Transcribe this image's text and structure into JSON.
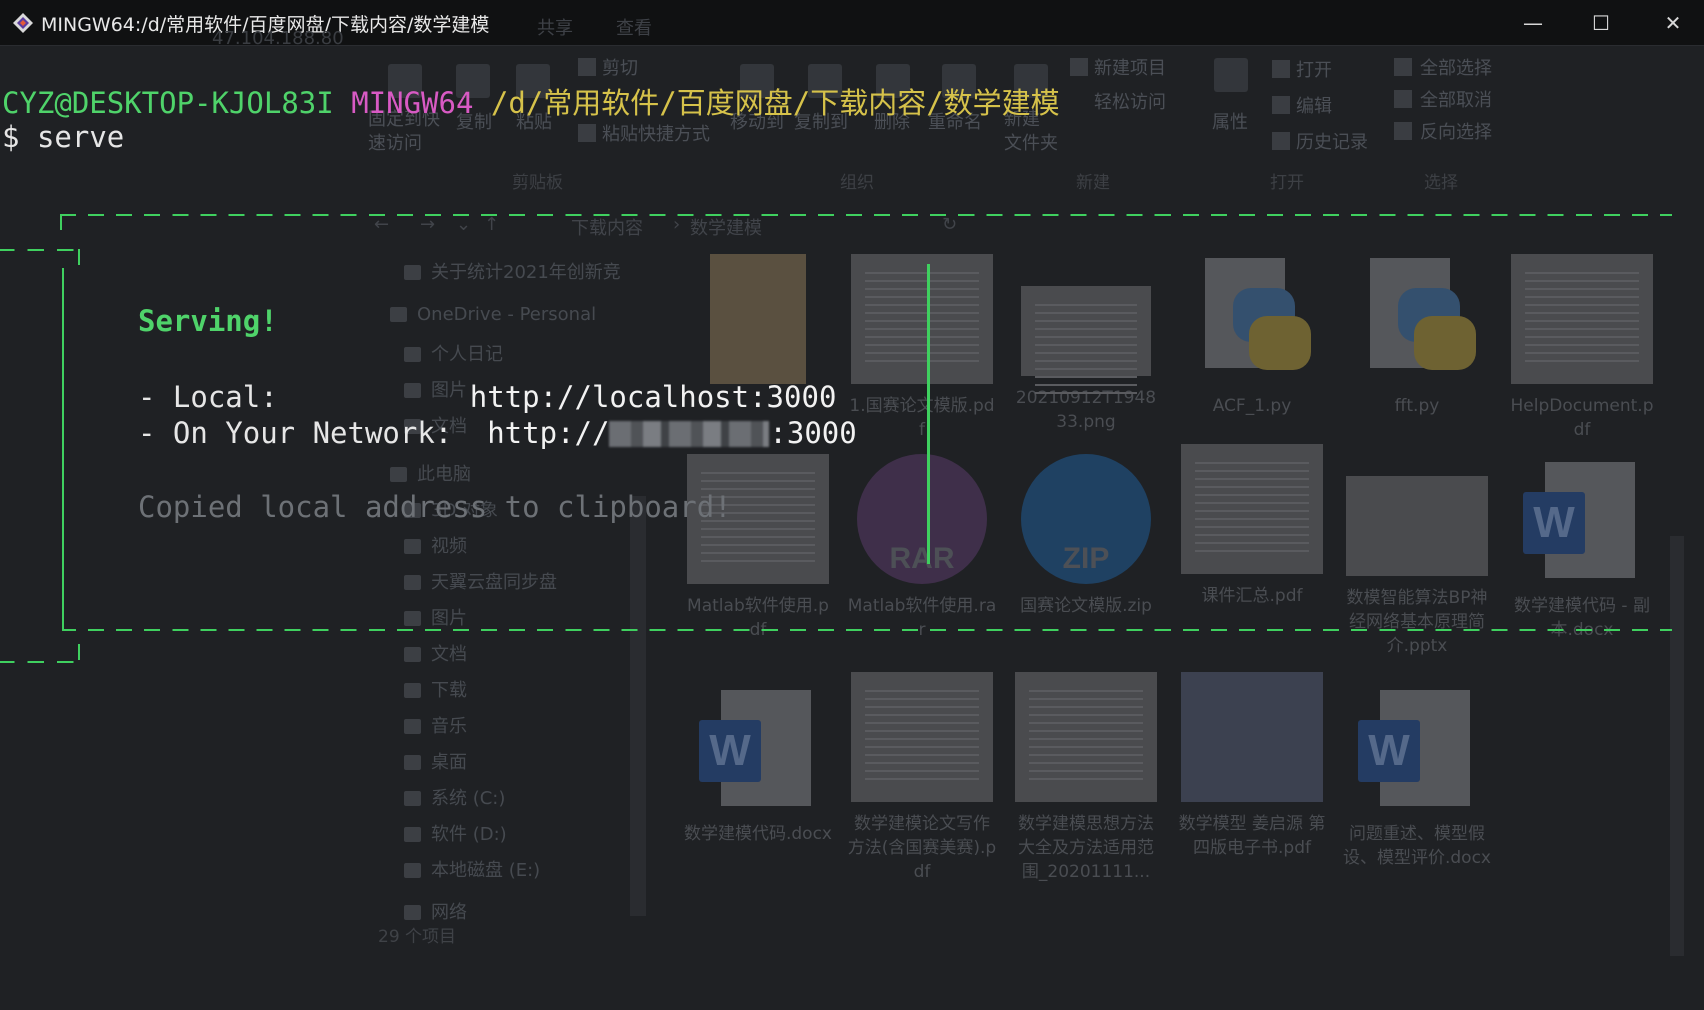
{
  "window": {
    "title": "MINGW64:/d/常用软件/百度网盘/下载内容/数学建模",
    "controls": {
      "minimize": "—",
      "maximize": "☐",
      "close": "✕"
    }
  },
  "explorer": {
    "ghost_tabs": [
      "共享",
      "查看"
    ],
    "ghost_address": "47.104.188.80",
    "ribbon": {
      "clipboard": {
        "pin": "固定到快\n速访问",
        "copy": "复制",
        "paste": "粘贴",
        "cut": "剪切",
        "paste_shortcut": "粘贴快捷方式",
        "group": "剪贴板"
      },
      "organize": {
        "move_to": "移动到",
        "copy_to": "复制到",
        "delete": "删除",
        "rename": "重命名",
        "group": "组织"
      },
      "new": {
        "new_item": "新建项目",
        "easy_access": "轻松访问",
        "new_folder": "新建\n文件夹",
        "group": "新建"
      },
      "open": {
        "properties": "属性",
        "open": "打开",
        "edit": "编辑",
        "history": "历史记录",
        "group": "打开"
      },
      "select": {
        "select_all": "全部选择",
        "select_none": "全部取消",
        "invert": "反向选择",
        "group": "选择"
      }
    },
    "breadcrumb": [
      "下载内容",
      "数学建模"
    ],
    "nav_items": [
      "关于统计2021年创新竞",
      "OneDrive - Personal",
      "个人日记",
      "图片",
      "文档",
      "此电脑",
      "3D 对象",
      "视频",
      "天翼云盘同步盘",
      "图片",
      "文档",
      "下载",
      "音乐",
      "桌面",
      "系统 (C:)",
      "软件 (D:)",
      "本地磁盘 (E:)",
      "网络"
    ],
    "files": [
      {
        "name": "",
        "kind": "folder"
      },
      {
        "name": "1.国赛论文模版.pdf",
        "kind": "doc"
      },
      {
        "name": "20210912T194833.png",
        "kind": "doc"
      },
      {
        "name": "ACF_1.py",
        "kind": "py"
      },
      {
        "name": "fft.py",
        "kind": "py"
      },
      {
        "name": "HelpDocument.pdf",
        "kind": "doc"
      },
      {
        "name": "Matlab软件使用.pdf",
        "kind": "doc"
      },
      {
        "name": "Matlab软件使用.rar",
        "kind": "rar",
        "badge": "RAR"
      },
      {
        "name": "国赛论文模版.zip",
        "kind": "zip",
        "badge": "ZIP"
      },
      {
        "name": "课件汇总.pdf",
        "kind": "doc"
      },
      {
        "name": "数模智能算法BP神经网络基本原理简介.pptx",
        "kind": "doc"
      },
      {
        "name": "数学建模代码 - 副本.docx",
        "kind": "word",
        "badge": "W"
      },
      {
        "name": "数学建模代码.docx",
        "kind": "word",
        "badge": "W"
      },
      {
        "name": "数学建模论文写作方法(含国赛美赛).pdf",
        "kind": "doc"
      },
      {
        "name": "数学建模思想方法大全及方法适用范围_20201111...",
        "kind": "doc"
      },
      {
        "name": "数学模型 姜启源 第四版电子书.pdf",
        "kind": "doc"
      },
      {
        "name": "问题重述、模型假设、模型评价.docx",
        "kind": "word",
        "badge": "W"
      }
    ],
    "status": "29 个项目"
  },
  "terminal": {
    "prompt_user": "CYZ@DESKTOP-KJOL83I",
    "prompt_env": "MINGW64",
    "prompt_path": "/d/常用软件/百度网盘/下载内容/数学建模",
    "prompt_symbol": "$",
    "command": "serve",
    "serving": "Serving!",
    "local_label": "- Local:",
    "local_url": "http://localhost:3000",
    "network_label": "- On Your Network:",
    "network_url_prefix": "http://",
    "network_url_suffix": ":3000",
    "copied": "Copied local address to clipboard!"
  },
  "colors": {
    "terminal_green": "#4fd36a",
    "terminal_magenta": "#d85ac4",
    "terminal_yellow": "#d6c24a",
    "background": "#1f2124"
  }
}
